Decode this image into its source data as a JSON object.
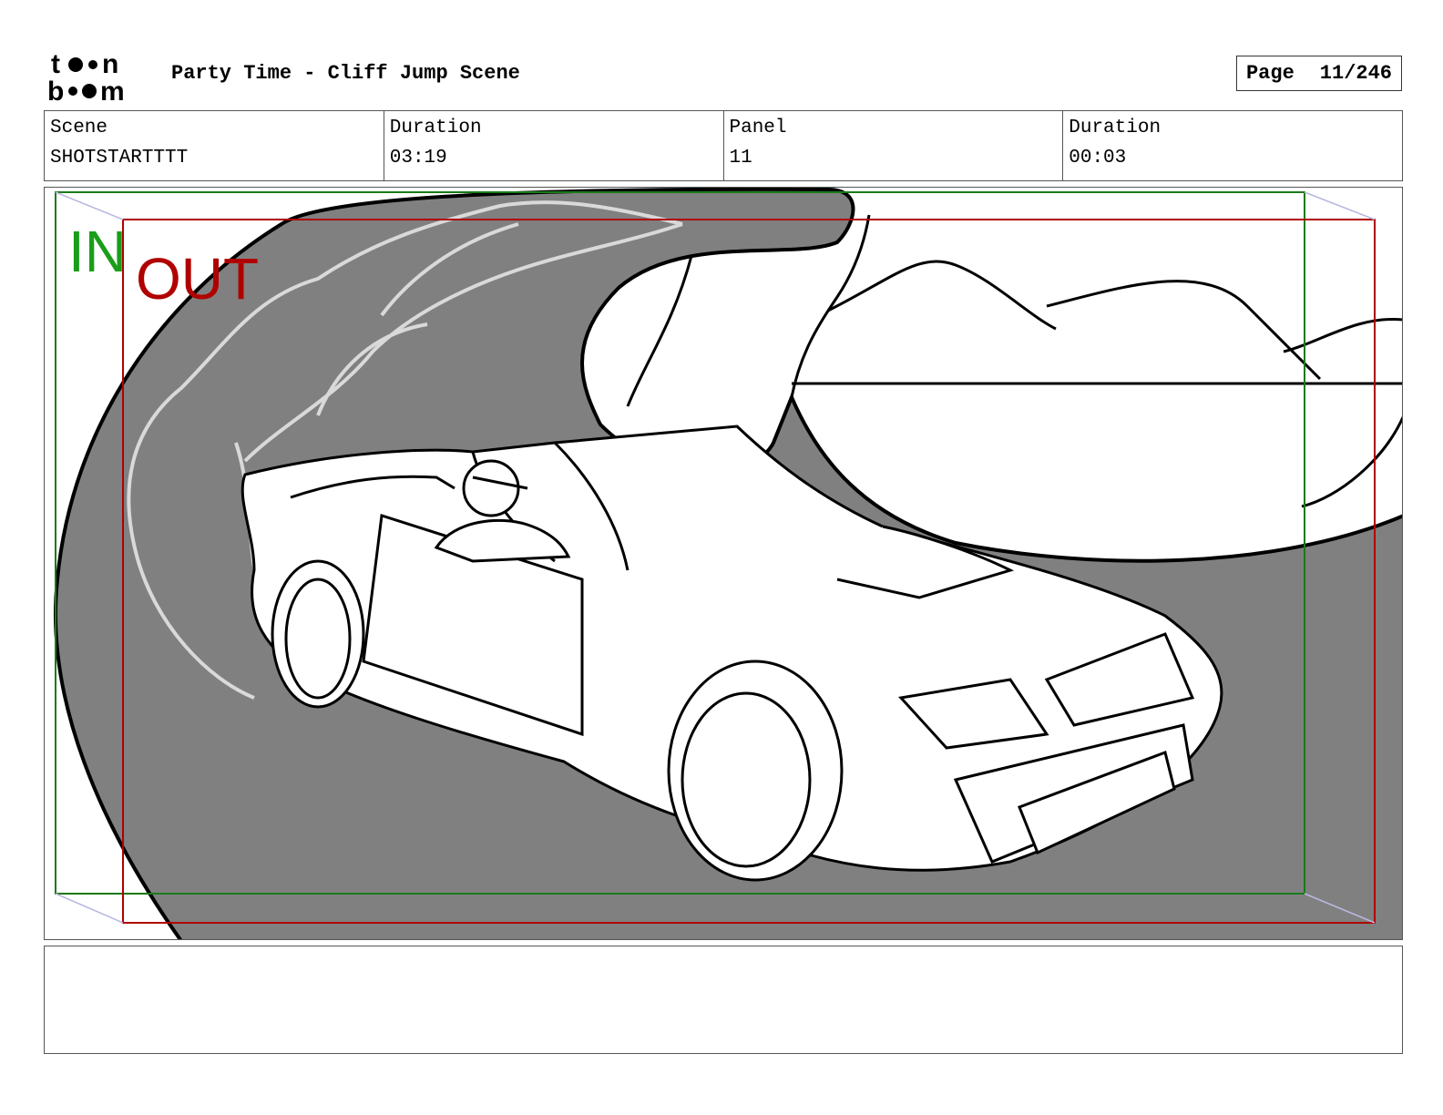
{
  "header": {
    "title": "Party Time - Cliff Jump Scene",
    "page_label": "Page",
    "page_value": "11/246"
  },
  "logo": {
    "line1": "toon",
    "line2": "boom"
  },
  "info": {
    "scene_label": "Scene",
    "scene_value": "SHOTSTARTTTT",
    "scene_duration_label": "Duration",
    "scene_duration_value": "03:19",
    "panel_label": "Panel",
    "panel_value": "11",
    "panel_duration_label": "Duration",
    "panel_duration_value": "00:03"
  },
  "panel": {
    "in_label": "IN",
    "out_label": "OUT",
    "in_color": "#1a9e1a",
    "out_color": "#b00000",
    "road_color": "#808080"
  },
  "notes": {
    "text": ""
  }
}
